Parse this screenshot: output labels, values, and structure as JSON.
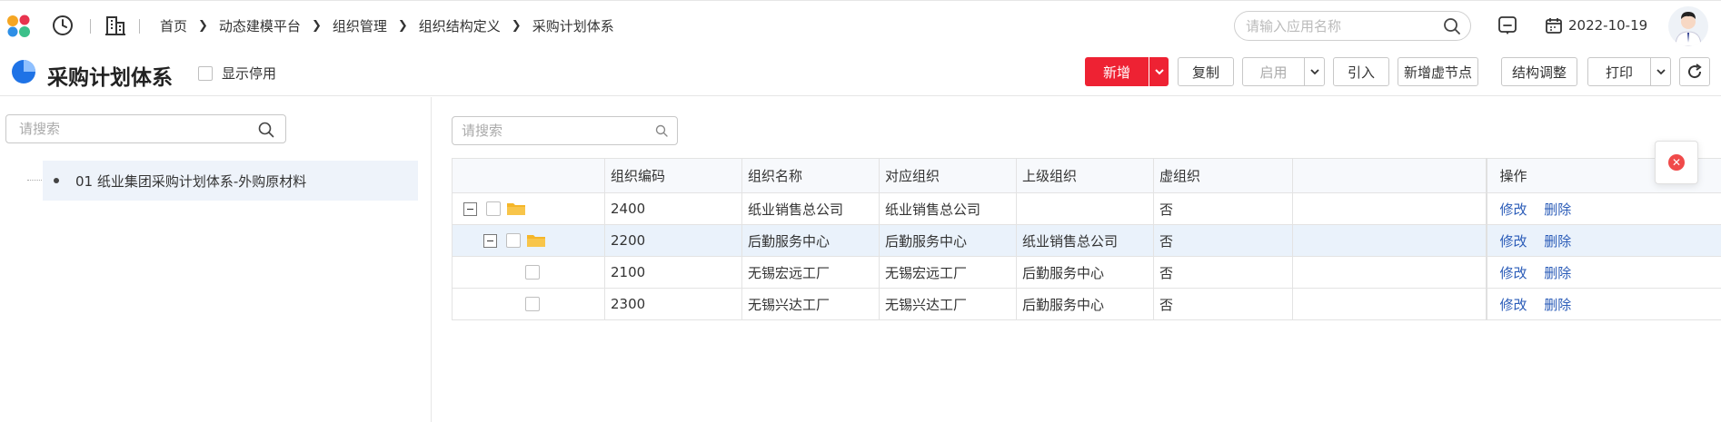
{
  "breadcrumb": [
    "首页",
    "动态建模平台",
    "组织管理",
    "组织结构定义",
    "采购计划体系"
  ],
  "search": {
    "placeholder": "请输入应用名称"
  },
  "date": "2022-10-19",
  "page": {
    "title": "采购计划体系",
    "show_disabled_label": "显示停用"
  },
  "toolbar": {
    "add": "新增",
    "copy": "复制",
    "enable": "启用",
    "import": "引入",
    "add_virtual": "新增虚节点",
    "restructure": "结构调整",
    "print": "打印"
  },
  "tree": {
    "search_placeholder": "请搜索",
    "node_label": "01 纸业集团采购计划体系-外购原材料"
  },
  "grid": {
    "search_placeholder": "请搜索",
    "columns": [
      "组织编码",
      "组织名称",
      "对应组织",
      "上级组织",
      "虚组织",
      "操作"
    ],
    "rows": [
      {
        "code": "2400",
        "name": "纸业销售总公司",
        "mapped": "纸业销售总公司",
        "parent": "",
        "virtual": "否",
        "level": 0,
        "folder": true
      },
      {
        "code": "2200",
        "name": "后勤服务中心",
        "mapped": "后勤服务中心",
        "parent": "纸业销售总公司",
        "virtual": "否",
        "level": 1,
        "folder": true
      },
      {
        "code": "2100",
        "name": "无锡宏远工厂",
        "mapped": "无锡宏远工厂",
        "parent": "后勤服务中心",
        "virtual": "否",
        "level": 2,
        "folder": false
      },
      {
        "code": "2300",
        "name": "无锡兴达工厂",
        "mapped": "无锡兴达工厂",
        "parent": "后勤服务中心",
        "virtual": "否",
        "level": 2,
        "folder": false
      }
    ],
    "edit_label": "修改",
    "delete_label": "删除"
  },
  "colors": {
    "primary": "#ee2233",
    "link": "#2b5cb8",
    "selected_row": "#eaf2fb",
    "folder": "#f5b629"
  }
}
